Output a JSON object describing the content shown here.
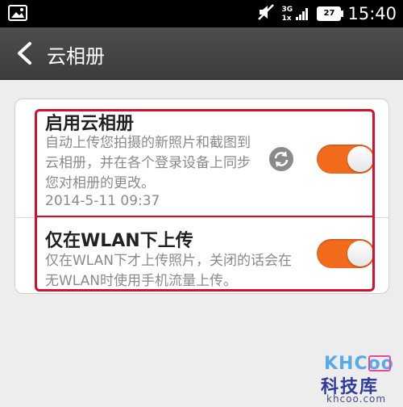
{
  "statusbar": {
    "network_top": "3G",
    "network_bottom": "1x",
    "battery": "27",
    "time": "15:40"
  },
  "titlebar": {
    "title": "云相册"
  },
  "settings": [
    {
      "title": "启用云相册",
      "description": "自动上传您拍摄的新照片和截图到云相册，并在各个登录设备上同步您对相册的更改。",
      "timestamp": "2014-5-11 09:37",
      "enabled": true
    },
    {
      "title": "仅在WLAN下上传",
      "description": "仅在WLAN下才上传照片，关闭的话会在无WLAN时使用手机流量上传。",
      "enabled": true
    }
  ],
  "watermark": {
    "logo": "KHCoo",
    "name": "科技库",
    "url": "khcoo.com"
  },
  "colors": {
    "toggle_on": "#f26b1d",
    "highlight": "#d0122a"
  }
}
